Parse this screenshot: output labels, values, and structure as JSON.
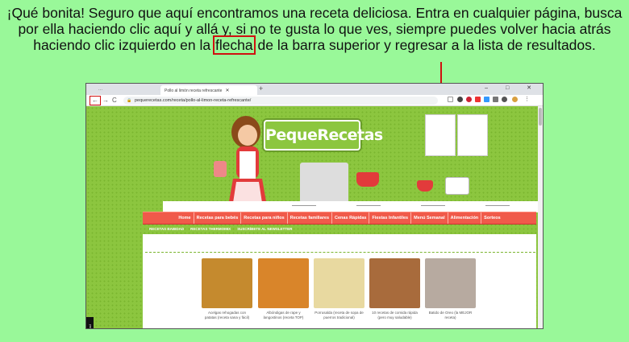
{
  "instruction": {
    "before": "¡Qué bonita! Seguro que aquí encontramos una receta deliciosa. Entra en cualquier página, busca por ella haciendo clic aquí y allá y, si no te gusta lo que ves, siempre puedes volver hacia atrás haciendo clic izquierdo en la ",
    "highlight": "flecha",
    "after": " de la barra superior  y regresar a la lista de resultados."
  },
  "colors": {
    "highlight_box": "#d01010",
    "page_background": "#99f899",
    "site_green": "#8cc63f",
    "nav_red": "#f05a4a"
  },
  "browser": {
    "tabs": [
      {
        "label": "···"
      },
      {
        "label": "Pollo al limón receta refrescante"
      }
    ],
    "newtab_icon": "plus-icon",
    "window_controls": "– □ ✕",
    "nav": {
      "back": "←",
      "forward": "→",
      "reload": "C"
    },
    "url": "pequerecetas.com/receta/pollo-al-limon-receta-refrescante/"
  },
  "site": {
    "logo": "PequeRecetas",
    "nav_items": [
      "Home",
      "Recetas para bebés",
      "Recetas para niños",
      "Recetas familiares",
      "Cenas Rápidas",
      "Fiestas Infantiles",
      "Menú Semanal",
      "Alimentación",
      "Sorteos"
    ],
    "subnav_items": [
      "RECETAS BABIDAD",
      "RECETAS THERMOMIX",
      "SUSCRÍBETE AL NEWSLETTER"
    ],
    "cards": [
      {
        "caption": "Acelgas rehogadas con patatas (receta sana y fácil)",
        "color": "#c58a2e"
      },
      {
        "caption": "Albóndigas de rape y langostinos (receta TOP)",
        "color": "#d9852a"
      },
      {
        "caption": "Porrusalda (receta de sopa de puerros tradicional)",
        "color": "#e8d9a0"
      },
      {
        "caption": "10 recetas de comida rápida (pero muy saludable)",
        "color": "#a86b3c"
      },
      {
        "caption": "Batido de Oreo (la MEJOR receta)",
        "color": "#b7aaa0"
      }
    ],
    "privacy_label": "Privacidad"
  }
}
